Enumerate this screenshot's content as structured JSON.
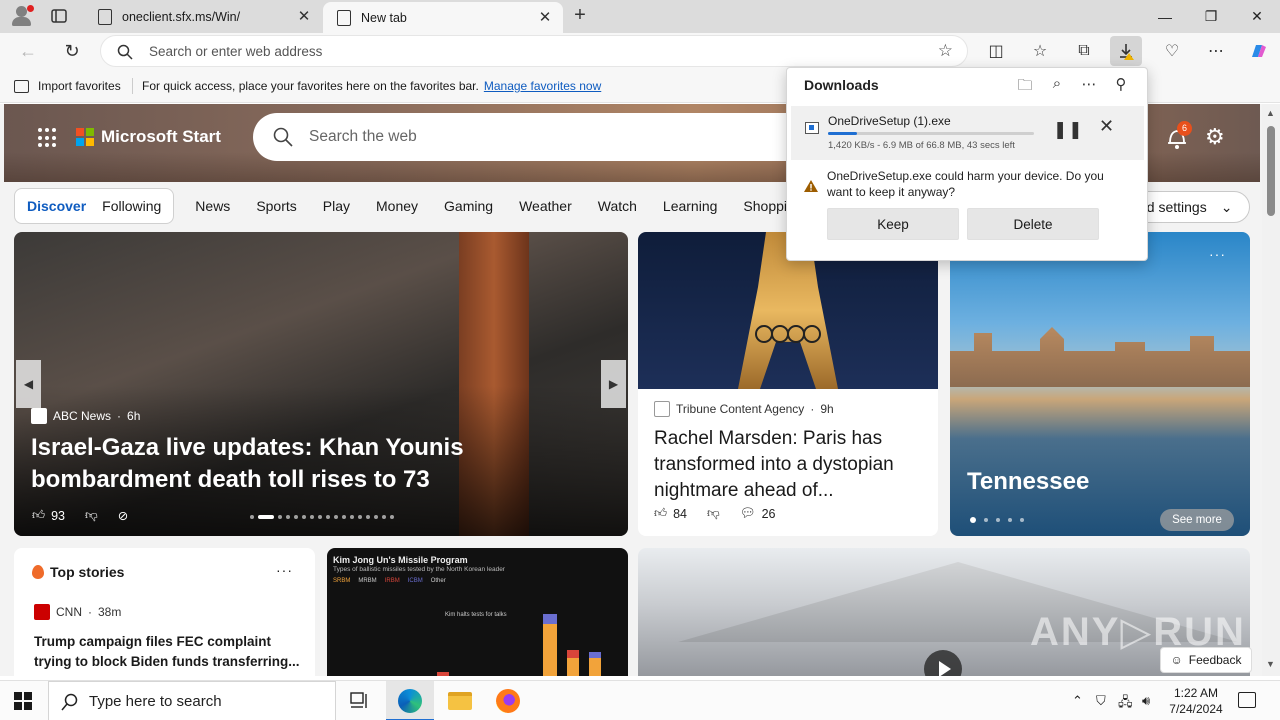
{
  "browser": {
    "tabs": [
      {
        "label": "oneclient.sfx.ms/Win/",
        "active": false
      },
      {
        "label": "New tab",
        "active": true
      }
    ],
    "address_placeholder": "Search or enter web address",
    "favorites_bar": {
      "import_label": "Import favorites",
      "hint": "For quick access, place your favorites here on the favorites bar.",
      "manage_link": "Manage favorites now"
    }
  },
  "downloads": {
    "title": "Downloads",
    "item": {
      "filename": "OneDriveSetup (1).exe",
      "status": "1,420 KB/s - 6.9 MB of 66.8 MB, 43 secs left",
      "progress_fraction": 0.14
    },
    "warning": "OneDriveSetup.exe could harm your device. Do you want to keep it anyway?",
    "keep_label": "Keep",
    "delete_label": "Delete"
  },
  "msn": {
    "brand": "Microsoft Start",
    "search_placeholder": "Search the web",
    "notification_count": "6",
    "tabs": {
      "discover": "Discover",
      "following": "Following"
    },
    "categories": [
      "News",
      "Sports",
      "Play",
      "Money",
      "Gaming",
      "Weather",
      "Watch",
      "Learning",
      "Shopping"
    ],
    "settings_label": "ed settings",
    "main_story": {
      "source": "ABC News",
      "age": "6h",
      "headline": "Israel-Gaza live updates: Khan Younis bombardment death toll rises to 73",
      "likes": "93"
    },
    "story2": {
      "source": "Tribune Content Agency",
      "age": "9h",
      "headline": "Rachel Marsden: Paris has transformed into a dystopian nightmare ahead of...",
      "likes": "84",
      "comments": "26"
    },
    "story3": {
      "title": "Tennessee",
      "more_label": "See more"
    },
    "top_stories": {
      "title": "Top stories",
      "source": "CNN",
      "age": "38m",
      "headline": "Trump campaign files FEC complaint trying to block Biden funds transferring..."
    },
    "kim_card": {
      "title": "Kim Jong Un's Missile Program",
      "subtitle": "Types of ballistic missiles tested by the North Korean leader",
      "legend": [
        "SRBM",
        "MRBM",
        "IRBM",
        "ICBM",
        "Other"
      ],
      "note": "Kim halts tests for talks"
    },
    "feedback_label": "Feedback",
    "watermark": "ANY RUN"
  },
  "taskbar": {
    "search_placeholder": "Type here to search",
    "time": "1:22 AM",
    "date": "7/24/2024"
  },
  "colors": {
    "accent": "#0f5cc0",
    "progress": "#1f6fd2"
  }
}
